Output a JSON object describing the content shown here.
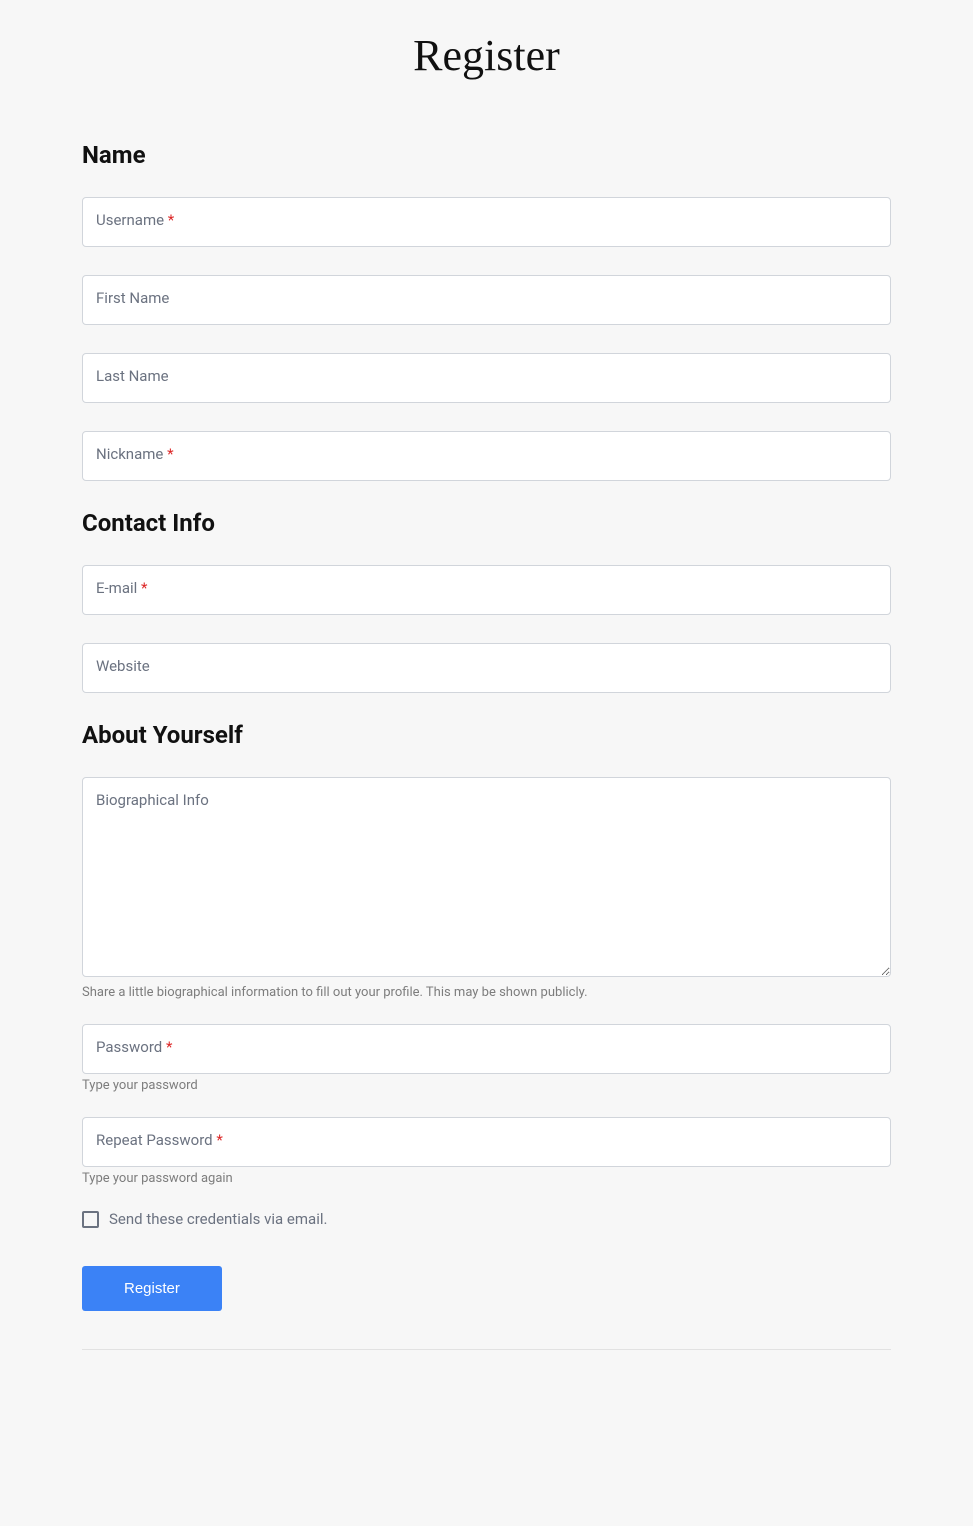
{
  "page": {
    "title": "Register"
  },
  "sections": {
    "name": {
      "title": "Name",
      "fields": {
        "username": {
          "label": "Username",
          "required": true
        },
        "first_name": {
          "label": "First Name",
          "required": false
        },
        "last_name": {
          "label": "Last Name",
          "required": false
        },
        "nickname": {
          "label": "Nickname",
          "required": true
        }
      }
    },
    "contact": {
      "title": "Contact Info",
      "fields": {
        "email": {
          "label": "E-mail",
          "required": true
        },
        "website": {
          "label": "Website",
          "required": false
        }
      }
    },
    "about": {
      "title": "About Yourself",
      "fields": {
        "bio": {
          "label": "Biographical Info",
          "helper": "Share a little biographical information to fill out your profile. This may be shown publicly."
        },
        "password": {
          "label": "Password",
          "required": true,
          "helper": "Type your password"
        },
        "repeat_password": {
          "label": "Repeat Password",
          "required": true,
          "helper": "Type your password again"
        }
      }
    }
  },
  "checkbox": {
    "label": "Send these credentials via email."
  },
  "submit": {
    "label": "Register"
  },
  "required_marker": "*"
}
